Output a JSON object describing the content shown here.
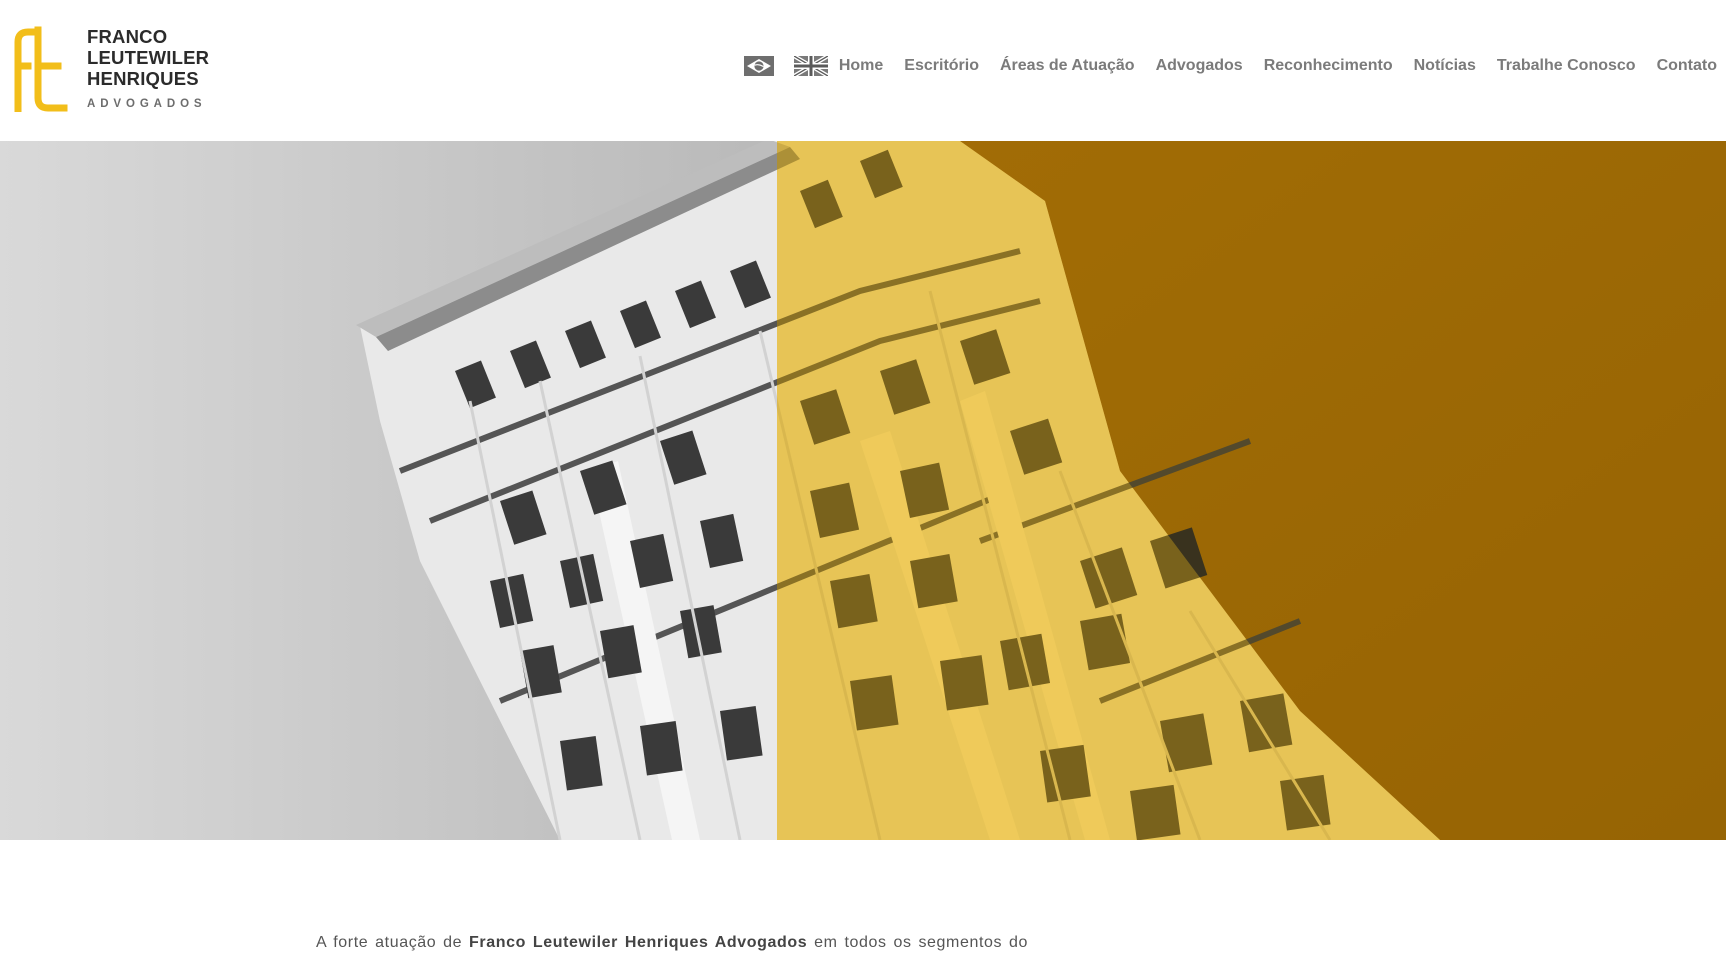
{
  "header": {
    "logo": {
      "monogram": "FLH",
      "line1": "FRANCO",
      "line2": "LEUTEWILER",
      "line3": "HENRIQUES",
      "subtitle": "ADVOGADOS",
      "accent_color": "#f2be1a"
    },
    "languages": [
      {
        "name": "brazil-flag-icon",
        "lang": "pt"
      },
      {
        "name": "uk-flag-icon",
        "lang": "en"
      }
    ],
    "nav": [
      {
        "label": "Home"
      },
      {
        "label": "Escritório"
      },
      {
        "label": "Áreas de Atuação"
      },
      {
        "label": "Advogados"
      },
      {
        "label": "Reconhecimento"
      },
      {
        "label": "Notícias"
      },
      {
        "label": "Trabalhe Conosco"
      },
      {
        "label": "Contato"
      }
    ]
  },
  "hero": {
    "image": "building-facade-grayscale-yellow-overlay",
    "overlay_color": "#f2be1a"
  },
  "intro": {
    "text_before": "A forte atuação de",
    "firm_name": "Franco Leutewiler Henriques Advogados",
    "text_after": "em todos os segmentos do"
  },
  "colors": {
    "brand_yellow": "#f2be1a",
    "nav_text": "#7b7b7b",
    "logo_text": "#2b2b2b"
  }
}
